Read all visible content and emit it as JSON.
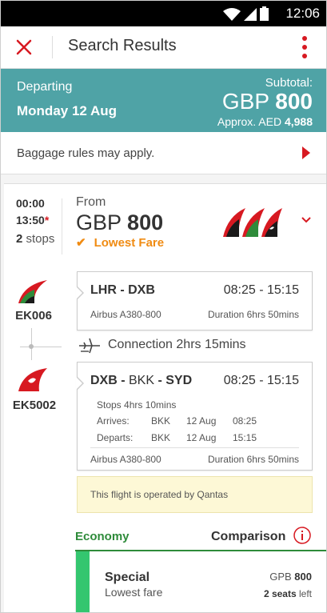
{
  "status": {
    "time": "12:06"
  },
  "header": {
    "title": "Search Results"
  },
  "summary": {
    "departing_label": "Departing",
    "date": "Monday 12 Aug",
    "subtotal_label": "Subtotal:",
    "currency": "GBP",
    "amount": "800",
    "approx_label": "Approx. AED",
    "approx_amount": "4,988"
  },
  "baggage": {
    "text": "Baggage rules may apply."
  },
  "result": {
    "depart": "00:00",
    "arrive": "13:50",
    "arrive_marker": "*",
    "stops_count": "2",
    "stops_label": "stops",
    "from_label": "From",
    "currency": "GBP",
    "amount": "800",
    "lowest_label": "Lowest Fare"
  },
  "flights": [
    {
      "code": "EK006",
      "route_from": "LHR",
      "route_to": "DXB",
      "times": "08:25 - 15:15",
      "aircraft": "Airbus A380-800",
      "duration": "Duration 6hrs 50mins"
    },
    {
      "code": "EK5002",
      "route_from": "DXB",
      "route_mid": "BKK",
      "route_to": "SYD",
      "times": "08:25 - 15:15",
      "stops": "Stops 4hrs 10mins",
      "arrives_label": "Arrives:",
      "arrives_airport": "BKK",
      "arrives_date": "12 Aug",
      "arrives_time": "08:25",
      "departs_label": "Departs:",
      "departs_airport": "BKK",
      "departs_date": "12 Aug",
      "departs_time": "15:15",
      "aircraft": "Airbus A380-800",
      "duration": "Duration 6hrs 50mins",
      "operated": "This flight is operated by Qantas"
    }
  ],
  "connection": {
    "text": "Connection 2hrs 15mins"
  },
  "cabin": {
    "economy": "Economy",
    "comparison": "Comparison"
  },
  "fare": {
    "name": "Special",
    "subtitle": "Lowest fare",
    "currency": "GPB",
    "amount": "800",
    "seats_count": "2 seats",
    "seats_label": "left"
  },
  "colors": {
    "accent": "#d71921",
    "teal": "#4fa3a6",
    "orange": "#f08b12",
    "green": "#2e8b3a",
    "fare_bar": "#34c66f"
  }
}
